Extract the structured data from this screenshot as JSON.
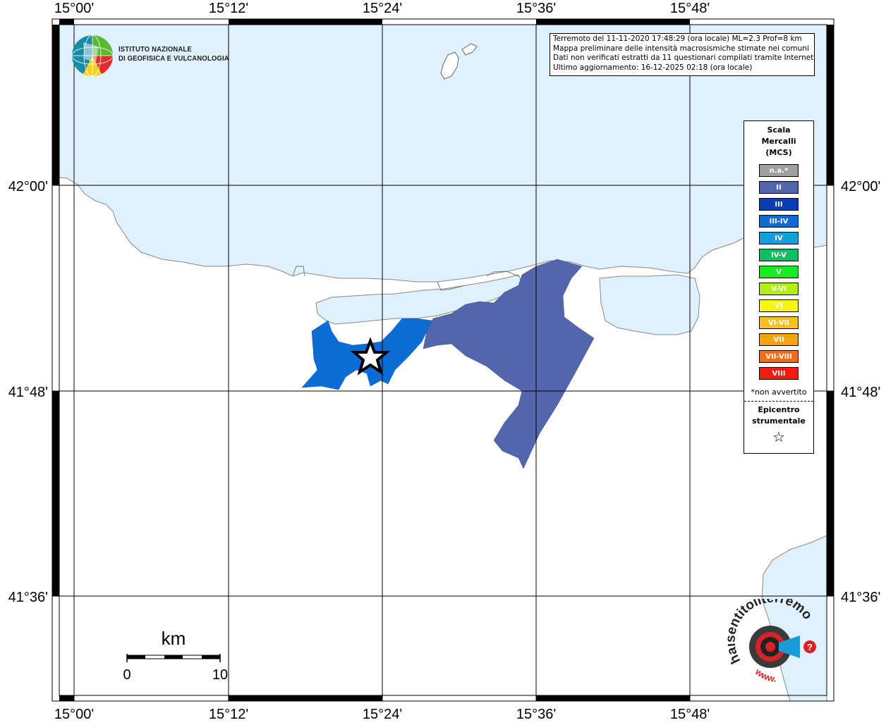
{
  "map": {
    "lon_labels": [
      "15°00'",
      "15°12'",
      "15°24'",
      "15°36'",
      "15°48'"
    ],
    "lat_labels": [
      "42°00'",
      "41°48'",
      "41°36'"
    ],
    "scalebar": {
      "unit": "km",
      "start": "0",
      "end": "10"
    }
  },
  "info": {
    "line1": "Terremoto del 11-11-2020 17:48:29 (ora locale) ML=2.3 Prof=8 km",
    "line2": "Mappa preliminare delle intensità macrosismiche stimate nei comuni",
    "line3": "Dati non verificati estratti da 11 questionari compilati tramite Internet.",
    "line4": "Ultimo aggiornamento: 16-12-2025 02:18 (ora locale)"
  },
  "legend": {
    "title_line1": "Scala",
    "title_line2": "Mercalli",
    "title_line3": "(MCS)",
    "items": [
      {
        "label": "n.a.*",
        "color": "#a0a0a0"
      },
      {
        "label": "II",
        "color": "#5366ad"
      },
      {
        "label": "III",
        "color": "#0a3cb5"
      },
      {
        "label": "III-IV",
        "color": "#0c6cd6"
      },
      {
        "label": "IV",
        "color": "#119fe0"
      },
      {
        "label": "IV-V",
        "color": "#0fbe63"
      },
      {
        "label": "V",
        "color": "#19ec1e"
      },
      {
        "label": "V-VI",
        "color": "#b4ee14"
      },
      {
        "label": "VI",
        "color": "#f6f418"
      },
      {
        "label": "VI-VII",
        "color": "#f7c21d"
      },
      {
        "label": "VII",
        "color": "#f7a30f"
      },
      {
        "label": "VII-VIII",
        "color": "#f76c14"
      },
      {
        "label": "VIII",
        "color": "#ef1e10"
      }
    ],
    "note": "*non avvertito",
    "epicenter_line1": "Epicentro",
    "epicenter_line2": "strumentale"
  },
  "logos": {
    "ingv_line1": "ISTITUTO NAZIONALE",
    "ingv_line2": "DI GEOFISICA E VULCANOLOGIA",
    "hsit_text": "haisentitoilterremoto.it",
    "hsit_www": "www."
  },
  "colors": {
    "sea": "#dff1fd",
    "land": "#ffffff",
    "intensity_II": "#5366ad",
    "intensity_III_IV": "#0c6cd6"
  }
}
